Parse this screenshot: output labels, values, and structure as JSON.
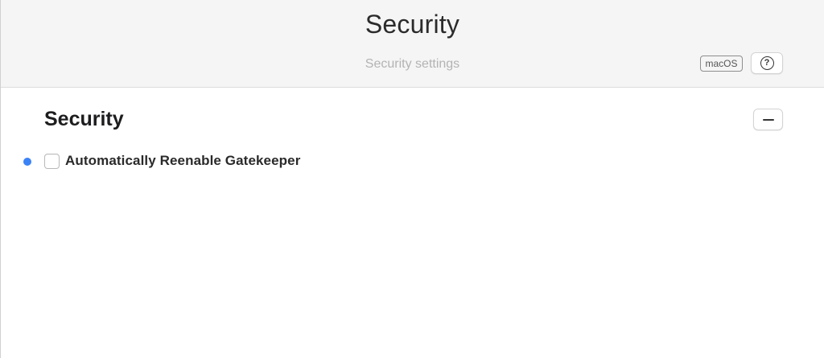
{
  "header": {
    "title": "Security",
    "subtitle": "Security settings",
    "platform_badge": "macOS",
    "help_icon": "question-circle-icon",
    "help_glyph": "?"
  },
  "section": {
    "title": "Security",
    "collapse_icon": "minus-icon",
    "settings": [
      {
        "label": "Automatically Reenable Gatekeeper",
        "checked": false,
        "modified": true
      }
    ]
  },
  "colors": {
    "modified_indicator": "#3b82f6",
    "header_background": "#f5f5f5",
    "subtitle_text": "#b3b3b3"
  }
}
